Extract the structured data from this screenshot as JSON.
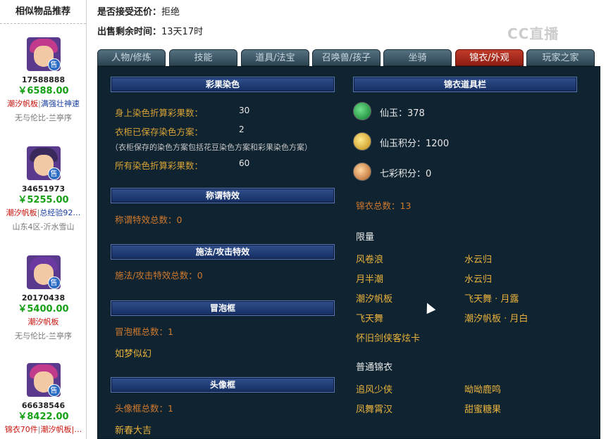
{
  "sidebar": {
    "title": "相似物品推荐",
    "items": [
      {
        "id": "17588888",
        "price": "￥6588.00",
        "tag1": "潮汐帆板",
        "tag2": "满强壮神速",
        "server": "无与伦比-兰亭序"
      },
      {
        "id": "34651973",
        "price": "￥5255.00",
        "tag1": "潮汐帆板",
        "tag2": "总经验92…",
        "server": "山东4区-沂水雪山"
      },
      {
        "id": "20170438",
        "price": "￥5400.00",
        "tag1": "潮汐帆板",
        "tag2": "",
        "server": "无与伦比-兰亭序"
      },
      {
        "id": "66638546",
        "price": "￥8422.00",
        "tag1": "锦衣70件",
        "tag2": "潮汐帆板|…",
        "server": ""
      }
    ],
    "sold_badge": "售"
  },
  "info": {
    "accept_label": "是否接受还价：",
    "accept_value": "拒绝",
    "time_label": "出售剩余时间：",
    "time_value": "13天17时"
  },
  "watermark": "CC直播",
  "tabs": [
    "人物/修炼",
    "技能",
    "道具/法宝",
    "召唤兽/孩子",
    "坐骑",
    "锦衣/外观",
    "玩家之家"
  ],
  "active_tab": "锦衣/外观",
  "left": {
    "dye": {
      "header": "彩果染色",
      "body_label": "身上染色折算彩果数：",
      "body_value": "30",
      "closet_label": "衣柜已保存染色方案：",
      "closet_value": "2",
      "note": "（衣柜保存的染色方案包括花豆染色方案和彩果染色方案）",
      "all_label": "所有染色折算彩果数：",
      "all_value": "60"
    },
    "title_fx": {
      "header": "称谓特效",
      "total": "称谓特效总数：0"
    },
    "spell_fx": {
      "header": "施法/攻击特效",
      "total": "施法/攻击特效总数：0"
    },
    "bubble": {
      "header": "冒泡框",
      "total": "冒泡框总数：1",
      "item": "如梦似幻"
    },
    "avatar_frame": {
      "header": "头像框",
      "total": "头像框总数：1",
      "item": "新春大吉"
    }
  },
  "right": {
    "header": "锦衣道具栏",
    "xianyu": "仙玉：378",
    "xianyu_points": "仙玉积分：1200",
    "qicai_points": "七彩积分：0",
    "total": "锦衣总数：13",
    "limited_label": "限量",
    "limited": [
      [
        "风卷浪",
        "水云归"
      ],
      [
        "月半潮",
        "水云归"
      ],
      [
        "潮汐帆板",
        "飞天舞 · 月露"
      ],
      [
        "飞天舞",
        "潮汐帆板 · 月白"
      ],
      [
        "怀旧剑侠客炫卡",
        ""
      ]
    ],
    "normal_label": "普通锦衣",
    "normal": [
      [
        "追风少侠",
        "呦呦鹿鸣"
      ],
      [
        "凤舞霄汉",
        "甜蜜糖果"
      ]
    ]
  },
  "colors": {
    "active_tab": "#a8281a",
    "panel_bg": "#0f2330",
    "gold": "#e8b23d",
    "price_green": "#15a015"
  }
}
